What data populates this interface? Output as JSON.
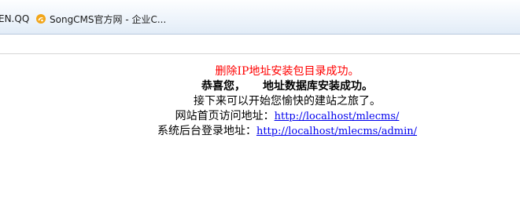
{
  "bookmarks": {
    "items": [
      {
        "label": "EN.QQ",
        "icon": "none"
      },
      {
        "label": "SongCMS官方网 - 企业C...",
        "icon": "songcms-logo-icon"
      }
    ]
  },
  "message": {
    "delete_ip": "删除IP地址安装包目录成功。",
    "congrats": "恭喜您，",
    "db_success": "地址数据库安装成功。",
    "next_step": "接下来可以开始您愉快的建站之旅了。",
    "home_label": "网站首页访问地址：",
    "home_url": "http://localhost/mlecms/",
    "admin_label": "系统后台登录地址：",
    "admin_url": "http://localhost/mlecms/admin/"
  },
  "colors": {
    "error_red": "#ff0000",
    "link_blue": "#0000ee",
    "logo_orange": "#f0a000"
  }
}
